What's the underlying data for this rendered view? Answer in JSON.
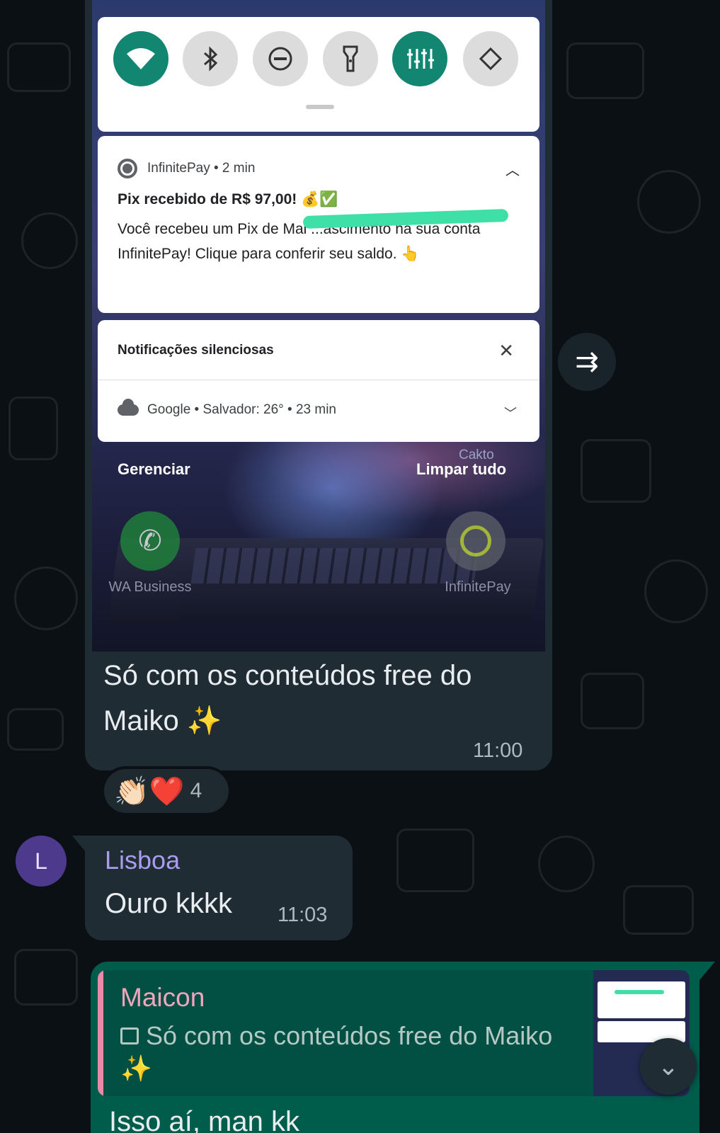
{
  "image_message": {
    "screenshot": {
      "quick_settings": {
        "tiles": [
          {
            "name": "wifi",
            "icon": "wifi-icon",
            "active": true
          },
          {
            "name": "bluetooth",
            "icon": "bluetooth-icon",
            "active": false
          },
          {
            "name": "do-not-disturb",
            "icon": "do-not-disturb-icon",
            "active": false
          },
          {
            "name": "flashlight",
            "icon": "flashlight-icon",
            "active": false
          },
          {
            "name": "equalizer",
            "icon": "equalizer-icon",
            "active": true
          },
          {
            "name": "auto-rotate",
            "icon": "auto-rotate-icon",
            "active": false
          }
        ]
      },
      "notification": {
        "app": "InfinitePay • 2 min",
        "title": "Pix recebido de R$ 97,00! 💰✅",
        "body": "Você recebeu um Pix de Mai           ...ascimento na sua conta InfinitePay! Clique para conferir seu saldo. 👆"
      },
      "silent": {
        "header": "Notificações silenciosas",
        "weather": "Google • Salvador: 26° • 23 min"
      },
      "manage": "Gerenciar",
      "clear_all": "Limpar tudo",
      "cakto": "Cakto",
      "apps": {
        "wa_business": "WA Business",
        "infinitepay": "InfinitePay"
      }
    },
    "caption": "Só com os conteúdos free do Maiko ✨",
    "time": "11:00",
    "reactions": {
      "emojis": "👏🏻❤️",
      "count": "4"
    }
  },
  "message_lisboa": {
    "avatar_letter": "L",
    "sender": "Lisboa",
    "text": "Ouro kkkk",
    "time": "11:03"
  },
  "message_reply": {
    "quoted_sender": "Maicon",
    "quoted_text": "Só com os conteúdos free do Maiko ✨",
    "text": "Isso aí, man kk"
  },
  "colors": {
    "background": "#0b1014",
    "incoming_bubble": "#202c33",
    "outgoing_bubble": "#005c4b",
    "accent_teal": "#138672"
  }
}
